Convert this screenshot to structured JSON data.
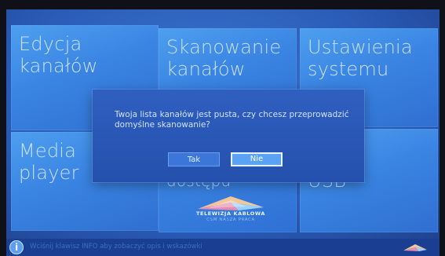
{
  "tiles": [
    {
      "label": "Edycja\nkanałów"
    },
    {
      "label": "Skanowanie\nkanałów"
    },
    {
      "label": "Ustawienia\nsystemu"
    },
    {
      "label": "Media\nplayer"
    },
    {
      "label": "dostępu"
    },
    {
      "label": "USB"
    }
  ],
  "logo": {
    "line1": "TELEWIZJA KABLOWA",
    "line2": "CSM NASZA PRACA"
  },
  "dialog": {
    "message": "Twoja lista kanałów jest pusta, czy chcesz przeprowadzić domyślne skanowanie?",
    "yes_label": "Tak",
    "no_label": "Nie",
    "selected": "Nie"
  },
  "statusbar": {
    "info_glyph": "i",
    "text": "Wciśnij klawisz INFO aby zobaczyć opis i wskazówki"
  },
  "colors": {
    "tile": "#3a84e2",
    "dialog": "#2a58b6",
    "statusbar": "#1a3f92"
  }
}
